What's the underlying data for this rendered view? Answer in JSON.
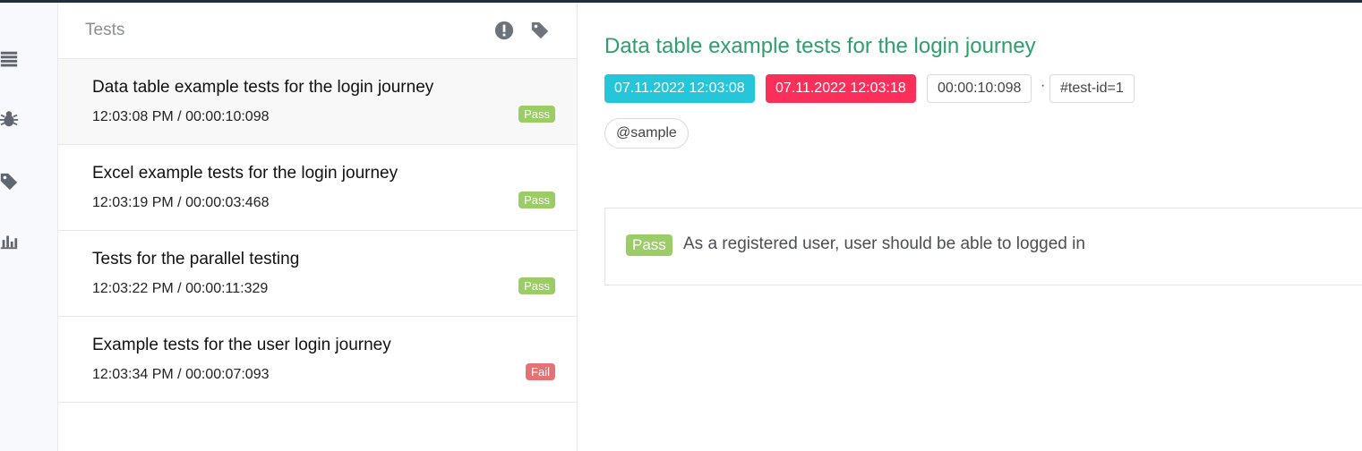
{
  "sidebar": {
    "icons": [
      "list-icon",
      "bug-icon",
      "tag-icon",
      "bar-chart-icon"
    ]
  },
  "list": {
    "title": "Tests",
    "header_icons": [
      "exclamation-icon",
      "tag-icon"
    ],
    "items": [
      {
        "name": "Data table example tests for the login journey",
        "meta": "12:03:08 PM / 00:00:10:098",
        "status": "Pass"
      },
      {
        "name": "Excel example tests for the login journey",
        "meta": "12:03:19 PM / 00:00:03:468",
        "status": "Pass"
      },
      {
        "name": "Tests for the parallel testing",
        "meta": "12:03:22 PM / 00:00:11:329",
        "status": "Pass"
      },
      {
        "name": "Example tests for the user login journey",
        "meta": "12:03:34 PM / 00:00:07:093",
        "status": "Fail"
      }
    ]
  },
  "detail": {
    "title": "Data table example tests for the login journey",
    "start_time": "07.11.2022 12:03:08",
    "end_time": "07.11.2022 12:03:18",
    "duration": "00:00:10:098",
    "separator": "·",
    "test_id": "#test-id=1",
    "tag": "@sample",
    "step": {
      "status": "Pass",
      "text": "As a registered user, user should be able to logged in"
    }
  },
  "colors": {
    "title_green": "#2e9e6b",
    "start_cyan": "#26c6da",
    "end_red": "#fc2e5a",
    "pass_green": "#9ccc65",
    "fail_red": "#e57373"
  }
}
